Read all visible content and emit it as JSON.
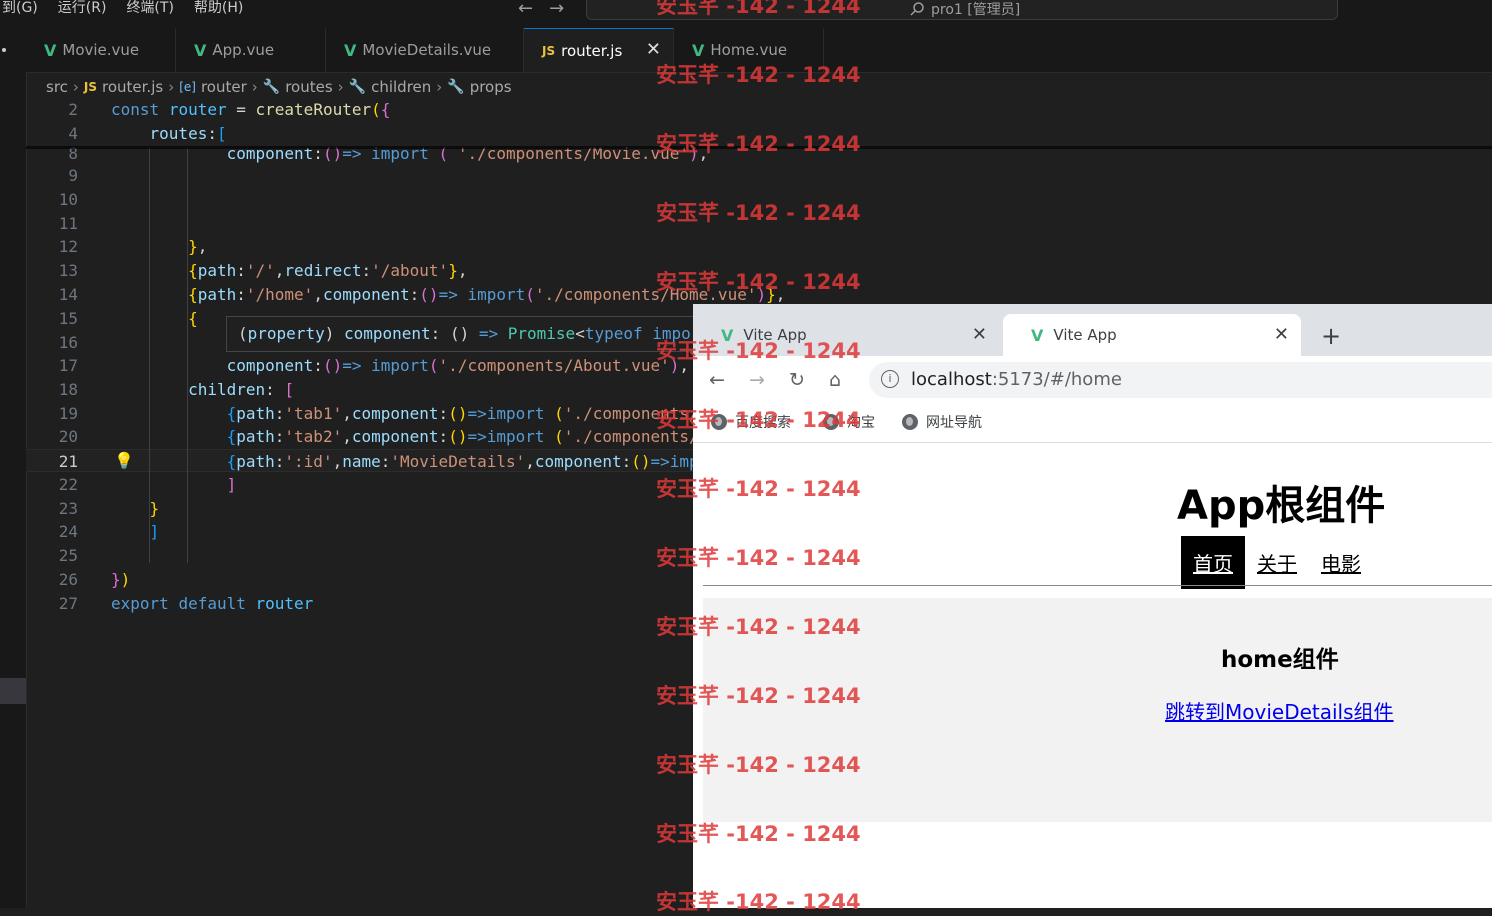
{
  "titlebar": {
    "menu": [
      "到(G)",
      "运行(R)",
      "终端(T)",
      "帮助(H)"
    ],
    "back": "←",
    "forward": "→",
    "command_center": "pro1 [管理员]"
  },
  "editor_tabs": [
    {
      "label": "Movie.vue",
      "type": "vue"
    },
    {
      "label": "App.vue",
      "type": "vue"
    },
    {
      "label": "MovieDetails.vue",
      "type": "vue"
    },
    {
      "label": "router.js",
      "type": "js",
      "active": true
    },
    {
      "label": "Home.vue",
      "type": "vue"
    }
  ],
  "breadcrumb": {
    "src": "src",
    "file": "router.js",
    "router": "router",
    "routes": "routes",
    "children": "children",
    "props": "props"
  },
  "code": {
    "lines": [
      {
        "n": "2",
        "html": "<span class=\"k\">const</span> <span class=\"v\">router</span> = <span class=\"f\">createRouter</span><span class=\"b1\">(</span><span class=\"b2\">{</span>"
      },
      {
        "n": "4",
        "html": "    <span class=\"p\">routes</span>:<span class=\"b3\">[</span>"
      },
      {
        "n": "8",
        "html": "            <span class=\"p\">component</span>:<span class=\"b2\">()</span><span class=\"k\">=></span> <span class=\"k\">import</span> <span class=\"b2\">(</span> <span class=\"s\">'./components/Movie.vue'</span><span class=\"b2\">)</span>,"
      },
      {
        "n": "9",
        "html": ""
      },
      {
        "n": "10",
        "html": ""
      },
      {
        "n": "11",
        "html": ""
      },
      {
        "n": "12",
        "html": "        <span class=\"b1\">}</span>,"
      },
      {
        "n": "13",
        "html": "        <span class=\"b1\">{</span><span class=\"p\">path</span>:<span class=\"s\">'/'</span>,<span class=\"p\">redirect</span>:<span class=\"s\">'/about'</span><span class=\"b1\">}</span>,"
      },
      {
        "n": "14",
        "html": "        <span class=\"b1\">{</span><span class=\"p\">path</span>:<span class=\"s\">'/home'</span>,<span class=\"p\">component</span>:<span class=\"b2\">()</span><span class=\"k\">=></span> <span class=\"k\">import</span><span class=\"b2\">(</span><span class=\"s\">'./components/Home.vue'</span><span class=\"b2\">)</span><span class=\"b1\">}</span>,"
      },
      {
        "n": "15",
        "html": "        <span class=\"b1\">{</span>"
      },
      {
        "n": "16",
        "html": ""
      },
      {
        "n": "17",
        "html": "            <span class=\"p\">component</span>:<span class=\"b2\">()</span><span class=\"k\">=></span> <span class=\"k\">import</span><span class=\"b2\">(</span><span class=\"s\">'./components/About.vue'</span><span class=\"b2\">)</span>,"
      },
      {
        "n": "18",
        "html": "        <span class=\"p\">children</span>: <span class=\"b2\">[</span>"
      },
      {
        "n": "19",
        "html": "            <span class=\"b3\">{</span><span class=\"p\">path</span>:<span class=\"s\">'tab1'</span>,<span class=\"p\">component</span>:<span class=\"b1\">()</span><span class=\"k\">=></span><span class=\"k\">import</span> <span class=\"b1\">(</span><span class=\"s\">'./components/</span>"
      },
      {
        "n": "20",
        "html": "            <span class=\"b3\">{</span><span class=\"p\">path</span>:<span class=\"s\">'tab2'</span>,<span class=\"p\">component</span>:<span class=\"b1\">()</span><span class=\"k\">=></span><span class=\"k\">import</span> <span class=\"b1\">(</span><span class=\"s\">'./components/</span>"
      },
      {
        "n": "21",
        "html": "            <span class=\"b3\">{</span><span class=\"p\">path</span>:<span class=\"s\">':id'</span>,<span class=\"p\">name</span>:<span class=\"s\">'MovieDetails'</span>,<span class=\"p\">component</span>:<span class=\"b1\">()</span><span class=\"k\">=></span><span class=\"k\">imp</span>",
        "current": true
      },
      {
        "n": "22",
        "html": "            <span class=\"b2\">]</span>"
      },
      {
        "n": "23",
        "html": "    <span class=\"b1\">}</span>"
      },
      {
        "n": "24",
        "html": "    <span class=\"b3\">]</span>"
      },
      {
        "n": "25",
        "html": ""
      },
      {
        "n": "26",
        "html": "<span class=\"b2\">}</span><span class=\"b1\">)</span>"
      },
      {
        "n": "27",
        "html": "<span class=\"k\">export</span> <span class=\"k\">default</span> <span class=\"v\">router</span>"
      }
    ],
    "hover_html": "(<span class=\"p\">property</span>) <span class=\"p\">component</span>: () <span class=\"k\">=></span> <span class=\"t\">Promise</span>&lt;<span class=\"k\">typeof</span> <span class=\"k\">impor</span>"
  },
  "browser": {
    "tabs": [
      {
        "title": "Vite App"
      },
      {
        "title": "Vite App",
        "active": true
      }
    ],
    "new_tab": "+",
    "url_host": "localhost",
    "url_rest": ":5173/#/home",
    "bookmarks": [
      "百度搜索",
      "淘宝",
      "网址导航"
    ]
  },
  "app": {
    "title": "App根组件",
    "nav": [
      "首页",
      "关于",
      "电影"
    ],
    "active_nav": 0,
    "home_title": "home组件",
    "link": "跳转到MovieDetails组件"
  },
  "watermark": "安玉芊 -142 - 1244"
}
